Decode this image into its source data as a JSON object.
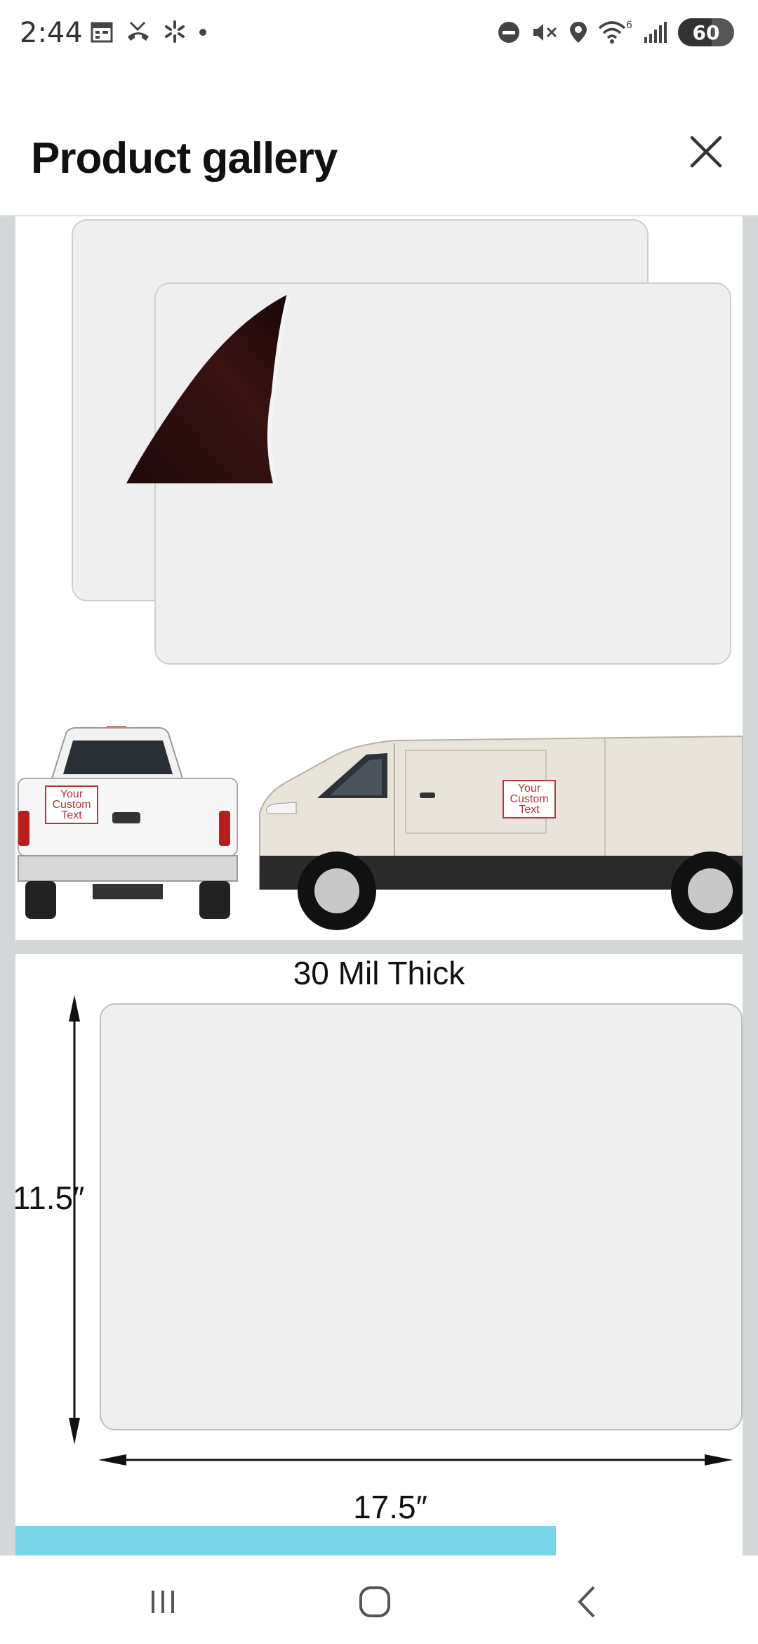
{
  "status_bar": {
    "time": "2:44",
    "battery": "60",
    "battery_level_percent": 60,
    "left_icons": [
      "calendar-icon",
      "missed-call-icon",
      "walmart-spark-icon",
      "dot-icon"
    ],
    "right_icons": [
      "do-not-disturb-icon",
      "vibrate-mute-icon",
      "location-icon",
      "wifi-icon",
      "signal-icon",
      "battery-icon"
    ],
    "wifi_badge": "6"
  },
  "header": {
    "title": "Product gallery",
    "close_icon": "close-icon"
  },
  "gallery": {
    "image1": {
      "label_line1": "Your",
      "label_line2": "Custom",
      "label_line3": "Text"
    },
    "image2": {
      "thickness": "30 Mil Thick",
      "height": "11.5″",
      "width": "17.5″"
    }
  },
  "nav_bar": {
    "icons": [
      "recent-apps-icon",
      "home-icon",
      "back-icon"
    ]
  },
  "colors": {
    "gallery_bg": "#d4d7d8",
    "sheet": "#efefef",
    "accent_cyan": "#7ad6e6",
    "label_red": "#b33333"
  }
}
